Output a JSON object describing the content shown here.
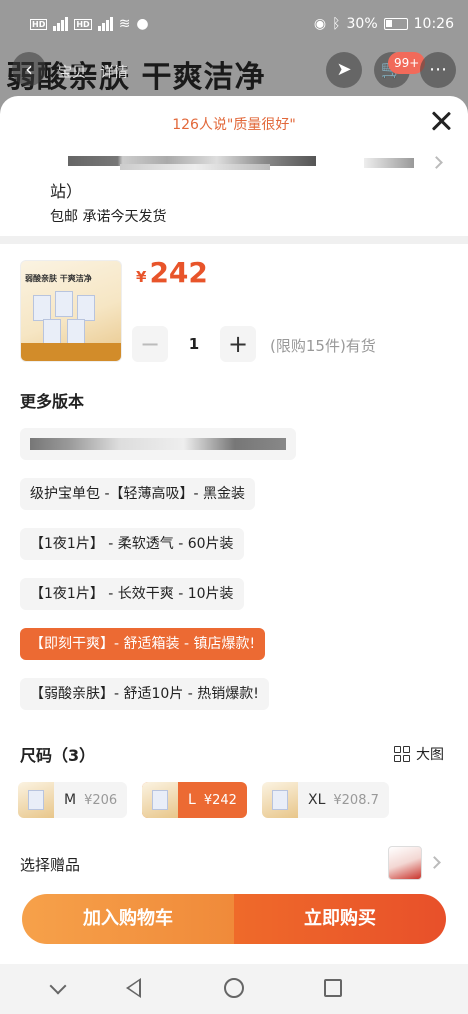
{
  "status_bar": {
    "hd1": "HD",
    "hd2": "HD",
    "battery_percent": "30%",
    "time": "10:26"
  },
  "background_page": {
    "banner_text": "弱酸亲肤 干爽洁净",
    "tab_a": "宝贝",
    "tab_b": "详情",
    "cart_badge": "99+"
  },
  "sheet": {
    "review_hint": "126人说\"质量很好\"",
    "address_suffix": "站）",
    "delivery_promise": "包邮 承诺今天发货",
    "price_symbol": "¥",
    "price": "242",
    "quantity": "1",
    "stepper_minus": "−",
    "stepper_plus": "+",
    "stock_note": "(限购15件)有货",
    "thumb_title": "弱酸亲肤 干爽洁净",
    "versions_title": "更多版本",
    "versions": [
      {
        "label": ""
      },
      {
        "label": "级护宝单包 -【轻薄高吸】- 黑金装"
      },
      {
        "label": "【1夜1片】 - 柔软透气 - 60片装"
      },
      {
        "label": "【1夜1片】 - 长效干爽 - 10片装"
      },
      {
        "label": "【即刻干爽】- 舒适箱装 - 镇店爆款!"
      },
      {
        "label": "【弱酸亲肤】- 舒适10片 - 热销爆款!"
      }
    ],
    "size_title": "尺码（3）",
    "big_picture_label": "大图",
    "sizes": [
      {
        "name": "M",
        "price": "¥206"
      },
      {
        "name": "L",
        "price": "¥242"
      },
      {
        "name": "XL",
        "price": "¥208.7"
      }
    ],
    "gift_label": "选择赠品",
    "add_to_cart": "加入购物车",
    "buy_now": "立即购买"
  },
  "colors": {
    "accent": "#ec6a33",
    "price": "#e8542a",
    "cart_button": "#f39a45",
    "buy_button": "#e8532a"
  },
  "icons": [
    "close-icon",
    "chevron-right-icon",
    "grid-icon",
    "nav-back-icon",
    "nav-home-icon",
    "nav-recent-icon",
    "nav-down-icon"
  ]
}
